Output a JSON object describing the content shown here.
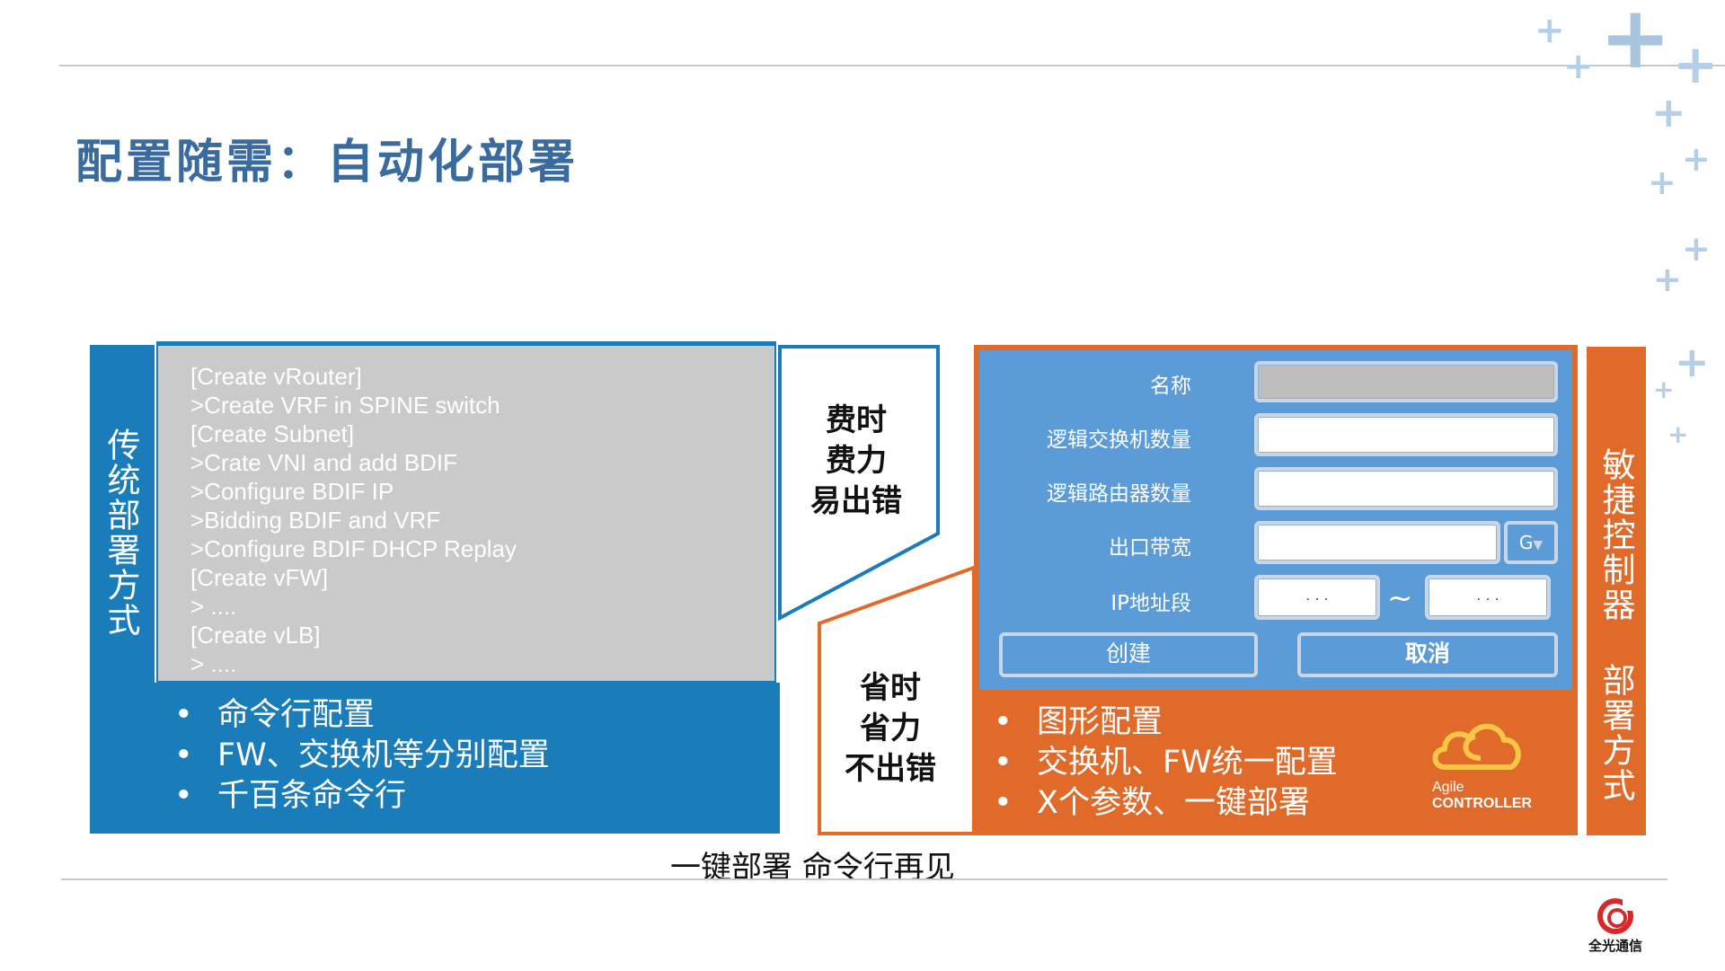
{
  "title": "配置随需：自动化部署",
  "traditional": {
    "side_label": "传统部署方式",
    "commands": [
      "[Create vRouter]",
      ">Create VRF in SPINE switch",
      "[Create Subnet]",
      ">Crate VNI and add BDIF",
      ">Configure BDIF IP",
      ">Bidding BDIF and VRF",
      ">Configure BDIF DHCP Replay",
      "[Create vFW]",
      "> ....",
      "[Create vLB]",
      "> ...."
    ],
    "bullets": [
      "命令行配置",
      "FW、交换机等分别配置",
      "千百条命令行"
    ],
    "callout": [
      "费时",
      "费力",
      "易出错"
    ]
  },
  "agile": {
    "side_label": "敏捷控制器 部署方式",
    "form": {
      "name_label": "名称",
      "switch_count_label": "逻辑交换机数量",
      "router_count_label": "逻辑路由器数量",
      "bandwidth_label": "出口带宽",
      "bandwidth_unit": "G",
      "bandwidth_arrow": "▼",
      "ip_range_label": "IP地址段",
      "ip_placeholder": ". . .",
      "range_sep": "~",
      "create_button": "创建",
      "cancel_button": "取消"
    },
    "bullets": [
      "图形配置",
      "交换机、FW统一配置",
      "X个参数、一键部署"
    ],
    "callout": [
      "省时",
      "省力",
      "不出错"
    ],
    "logo_line1": "Agile",
    "logo_line2": "CONTROLLER"
  },
  "footer_caption": "一键部署 命令行再见",
  "company_logo_text": "全光通信",
  "colors": {
    "blue": "#1a7cb8",
    "orange": "#e06a2a",
    "form_blue": "#5b9bd8",
    "title": "#3a6b9e"
  }
}
